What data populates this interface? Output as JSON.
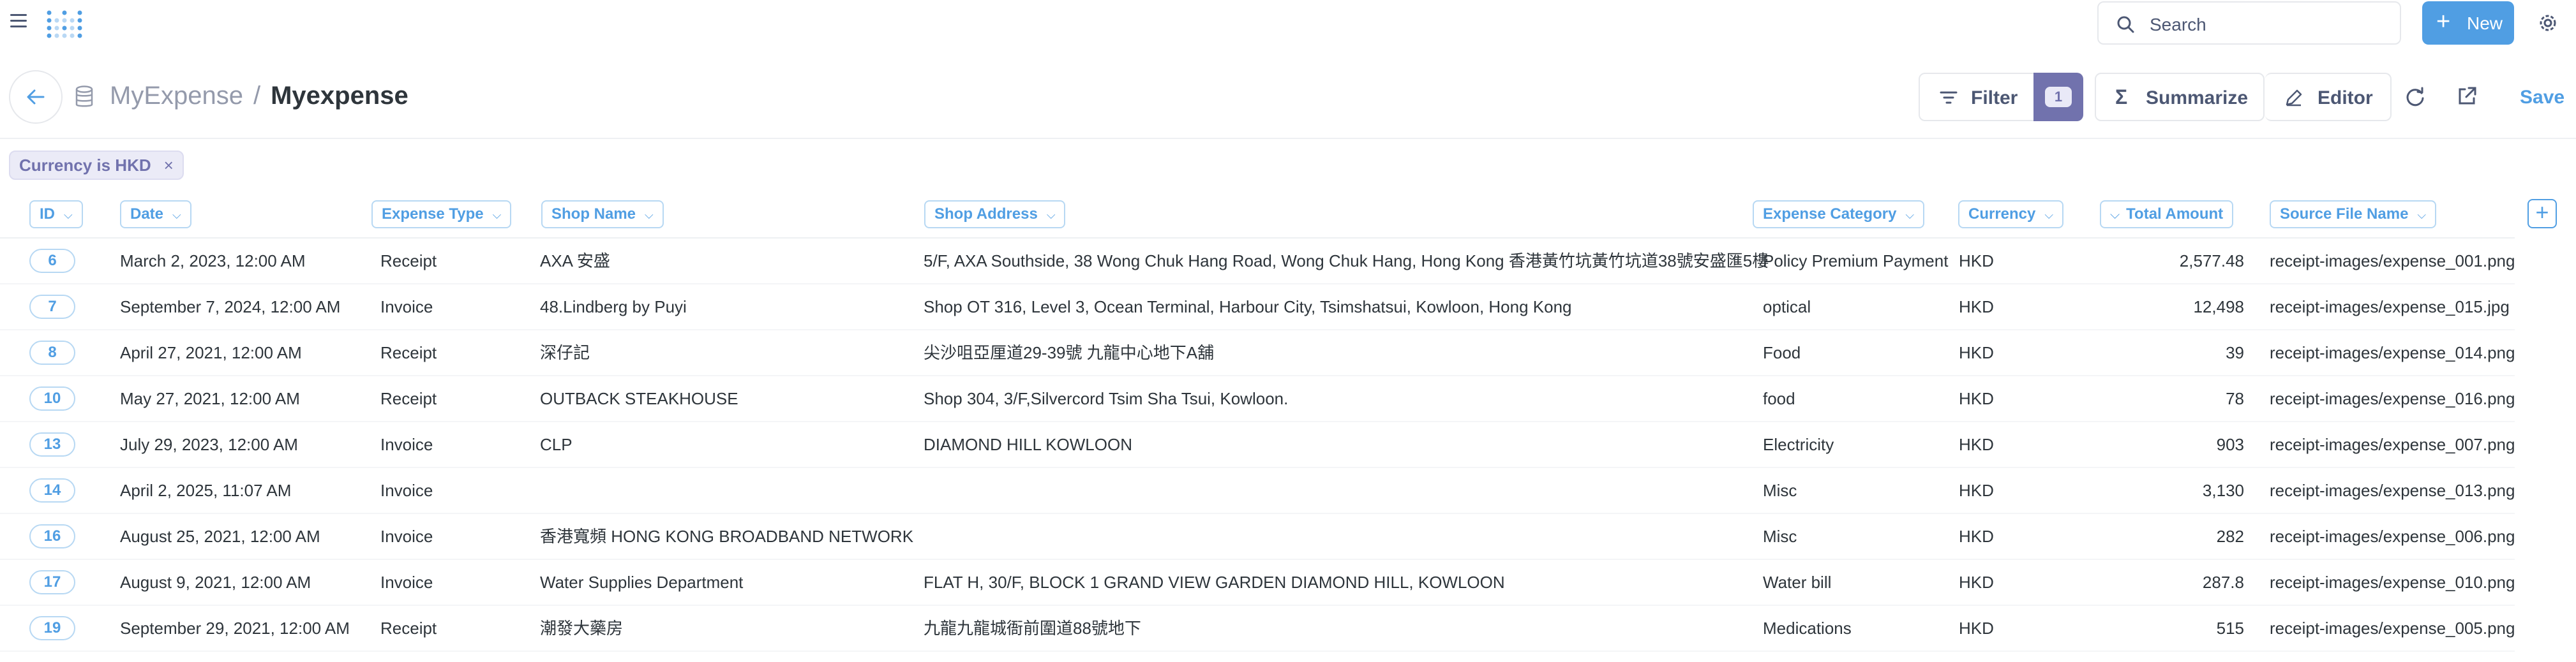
{
  "nav": {
    "search_label": "Search",
    "new_label": "New"
  },
  "header": {
    "breadcrumb_db": "MyExpense",
    "breadcrumb_sep": "/",
    "title": "Myexpense",
    "filter_label": "Filter",
    "filter_count": "1",
    "summarize_label": "Summarize",
    "editor_label": "Editor",
    "save_label": "Save"
  },
  "active_filter": {
    "label": "Currency is HKD",
    "remove": "×"
  },
  "columns": {
    "id": "ID",
    "date": "Date",
    "expense_type": "Expense Type",
    "shop_name": "Shop Name",
    "shop_address": "Shop Address",
    "expense_category": "Expense Category",
    "currency": "Currency",
    "total_amount": "Total Amount",
    "source_file": "Source File Name"
  },
  "rows": [
    {
      "id": "6",
      "date": "March 2, 2023, 12:00 AM",
      "type": "Receipt",
      "shop": "AXA 安盛",
      "address": "5/F, AXA Southside, 38 Wong Chuk Hang Road, Wong Chuk Hang, Hong Kong 香港黃竹坑黃竹坑道38號安盛匯5樓",
      "category": "Policy Premium Payment",
      "currency": "HKD",
      "amount": "2,577.48",
      "file": "receipt-images/expense_001.png"
    },
    {
      "id": "7",
      "date": "September 7, 2024, 12:00 AM",
      "type": "Invoice",
      "shop": "48.Lindberg by Puyi",
      "address": "Shop OT 316, Level 3, Ocean Terminal, Harbour City, Tsimshatsui, Kowloon, Hong Kong",
      "category": "optical",
      "currency": "HKD",
      "amount": "12,498",
      "file": "receipt-images/expense_015.jpg"
    },
    {
      "id": "8",
      "date": "April 27, 2021, 12:00 AM",
      "type": "Receipt",
      "shop": "深仔記",
      "address": "尖沙咀亞厘道29-39號 九龍中心地下A舖",
      "category": "Food",
      "currency": "HKD",
      "amount": "39",
      "file": "receipt-images/expense_014.png"
    },
    {
      "id": "10",
      "date": "May 27, 2021, 12:00 AM",
      "type": "Receipt",
      "shop": "OUTBACK STEAKHOUSE",
      "address": "Shop 304, 3/F,Silvercord Tsim Sha Tsui, Kowloon.",
      "category": "food",
      "currency": "HKD",
      "amount": "78",
      "file": "receipt-images/expense_016.png"
    },
    {
      "id": "13",
      "date": "July 29, 2023, 12:00 AM",
      "type": "Invoice",
      "shop": "CLP",
      "address": "DIAMOND HILL KOWLOON",
      "category": "Electricity",
      "currency": "HKD",
      "amount": "903",
      "file": "receipt-images/expense_007.png"
    },
    {
      "id": "14",
      "date": "April 2, 2025, 11:07 AM",
      "type": "Invoice",
      "shop": "",
      "address": "",
      "category": "Misc",
      "currency": "HKD",
      "amount": "3,130",
      "file": "receipt-images/expense_013.png"
    },
    {
      "id": "16",
      "date": "August 25, 2021, 12:00 AM",
      "type": "Invoice",
      "shop": "香港寬頻 HONG KONG BROADBAND NETWORK",
      "address": "",
      "category": "Misc",
      "currency": "HKD",
      "amount": "282",
      "file": "receipt-images/expense_006.png"
    },
    {
      "id": "17",
      "date": "August 9, 2021, 12:00 AM",
      "type": "Invoice",
      "shop": "Water Supplies Department",
      "address": "FLAT H, 30/F, BLOCK 1 GRAND VIEW GARDEN DIAMOND HILL, KOWLOON",
      "category": "Water bill",
      "currency": "HKD",
      "amount": "287.8",
      "file": "receipt-images/expense_010.png"
    },
    {
      "id": "19",
      "date": "September 29, 2021, 12:00 AM",
      "type": "Receipt",
      "shop": "潮發大藥房",
      "address": "九龍九龍城衙前圍道88號地下",
      "category": "Medications",
      "currency": "HKD",
      "amount": "515",
      "file": "receipt-images/expense_005.png"
    }
  ],
  "colors": {
    "brand": "#509ee3",
    "filter": "#7172ad",
    "text": "#2e353b",
    "muted": "#949aab"
  }
}
